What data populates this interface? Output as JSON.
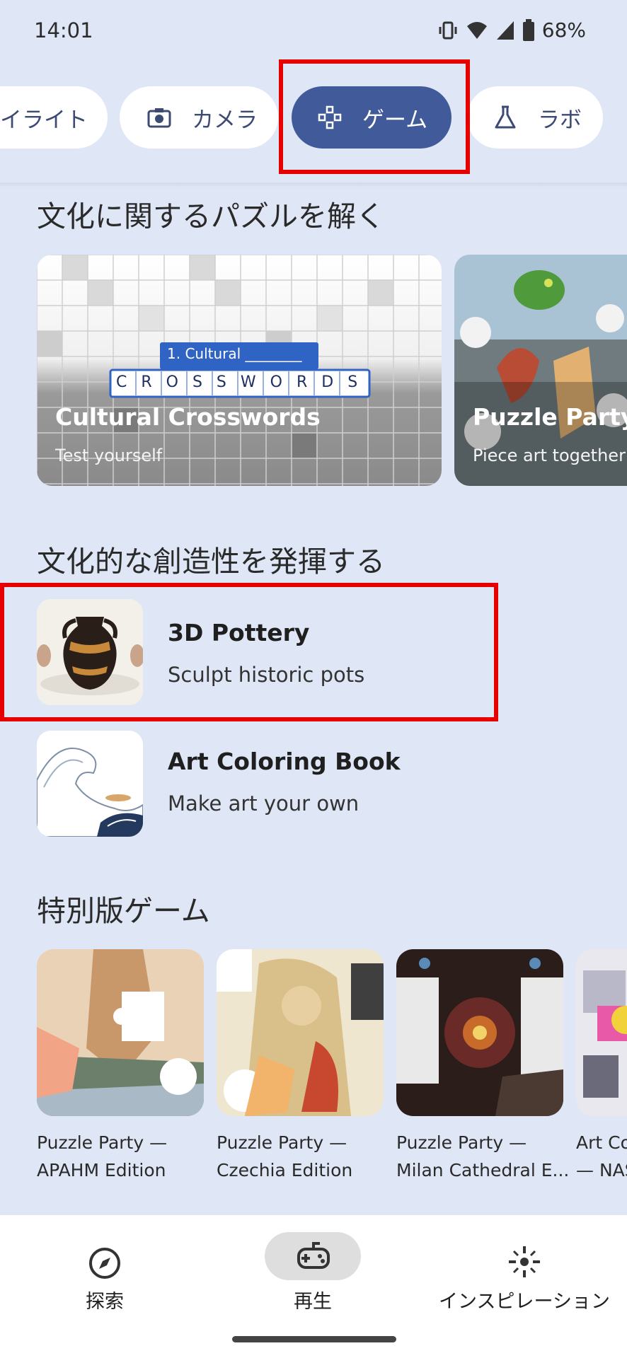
{
  "status": {
    "time": "14:01",
    "battery": "68%"
  },
  "chips": [
    {
      "label": "イライト",
      "icon": "highlight-icon"
    },
    {
      "label": "カメラ",
      "icon": "camera-icon"
    },
    {
      "label": "ゲーム",
      "icon": "gamepad-icon",
      "active": true
    },
    {
      "label": "ラボ",
      "icon": "flask-icon"
    }
  ],
  "sections": {
    "puzzles": {
      "title": "文化に関するパズルを解く",
      "cards": [
        {
          "title": "Cultural Crosswords",
          "subtitle": "Test yourself",
          "clue": "1. Cultural ________",
          "word": "CROSSWORDS"
        },
        {
          "title": "Puzzle Party",
          "subtitle": "Piece art together"
        }
      ]
    },
    "creativity": {
      "title": "文化的な創造性を発揮する",
      "items": [
        {
          "title": "3D Pottery",
          "subtitle": "Sculpt historic pots"
        },
        {
          "title": "Art Coloring Book",
          "subtitle": "Make art your own"
        }
      ]
    },
    "special": {
      "title": "特別版ゲーム",
      "tiles": [
        {
          "line1": "Puzzle Party —",
          "line2": "APAHM Edition"
        },
        {
          "line1": "Puzzle Party —",
          "line2": "Czechia Edition"
        },
        {
          "line1": "Puzzle Party —",
          "line2": "Milan Cathedral E..."
        },
        {
          "line1": "Art Co",
          "line2": "— NAS"
        }
      ]
    }
  },
  "bottom_nav": [
    {
      "label": "探索",
      "icon": "compass-icon"
    },
    {
      "label": "再生",
      "icon": "gamepad-icon",
      "active": true
    },
    {
      "label": "インスピレーション",
      "icon": "sparkle-icon"
    }
  ],
  "colors": {
    "background": "#dfe6f5",
    "chip_active": "#415a9a",
    "highlight_box": "#e60000"
  }
}
